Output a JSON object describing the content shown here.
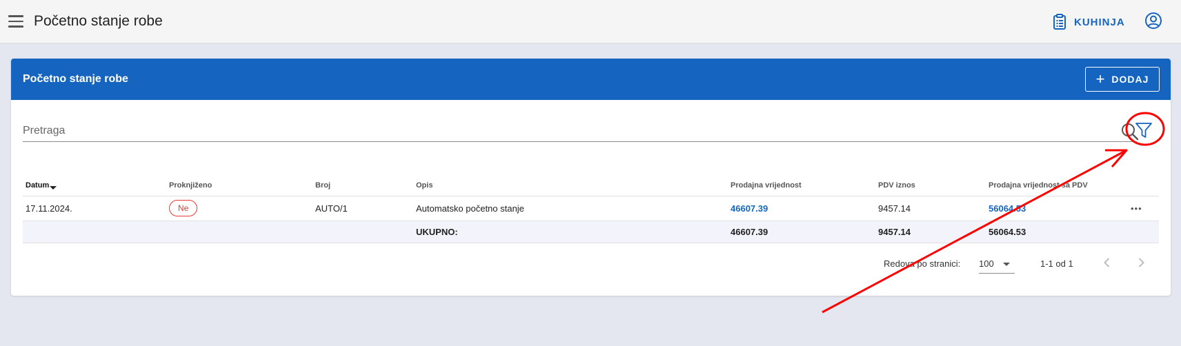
{
  "header": {
    "title": "Početno stanje robe",
    "kitchen_label": "KUHINJA",
    "icons": {
      "menu": "hamburger-menu-icon",
      "kitchen": "clipboard-list-icon",
      "account": "account-circle-icon"
    }
  },
  "card": {
    "title": "Početno stanje robe",
    "add_label": "DODAJ"
  },
  "search": {
    "placeholder": "Pretraga",
    "value": ""
  },
  "table": {
    "headers": {
      "datum": "Datum",
      "proknjizeno": "Proknjiženo",
      "broj": "Broj",
      "opis": "Opis",
      "prodajna": "Prodajna vrijednost",
      "pdv": "PDV iznos",
      "prodajna_pdv": "Prodajna vrijednost sa PDV"
    },
    "rows": [
      {
        "datum": "17.11.2024.",
        "proknjizeno": "Ne",
        "broj": "AUTO/1",
        "opis": "Automatsko početno stanje",
        "prodajna": "46607.39",
        "pdv": "9457.14",
        "prodajna_pdv": "56064.53",
        "more": "•••"
      }
    ],
    "totals": {
      "label": "UKUPNO:",
      "prodajna": "46607.39",
      "pdv": "9457.14",
      "prodajna_pdv": "56064.53"
    }
  },
  "pagination": {
    "rows_per_page_label": "Redova po stranici:",
    "rows_per_page": "100",
    "range": "1-1 od 1"
  },
  "colors": {
    "primary": "#1565c0",
    "badge_red": "#e53935",
    "annotation_red": "#ff0000"
  }
}
